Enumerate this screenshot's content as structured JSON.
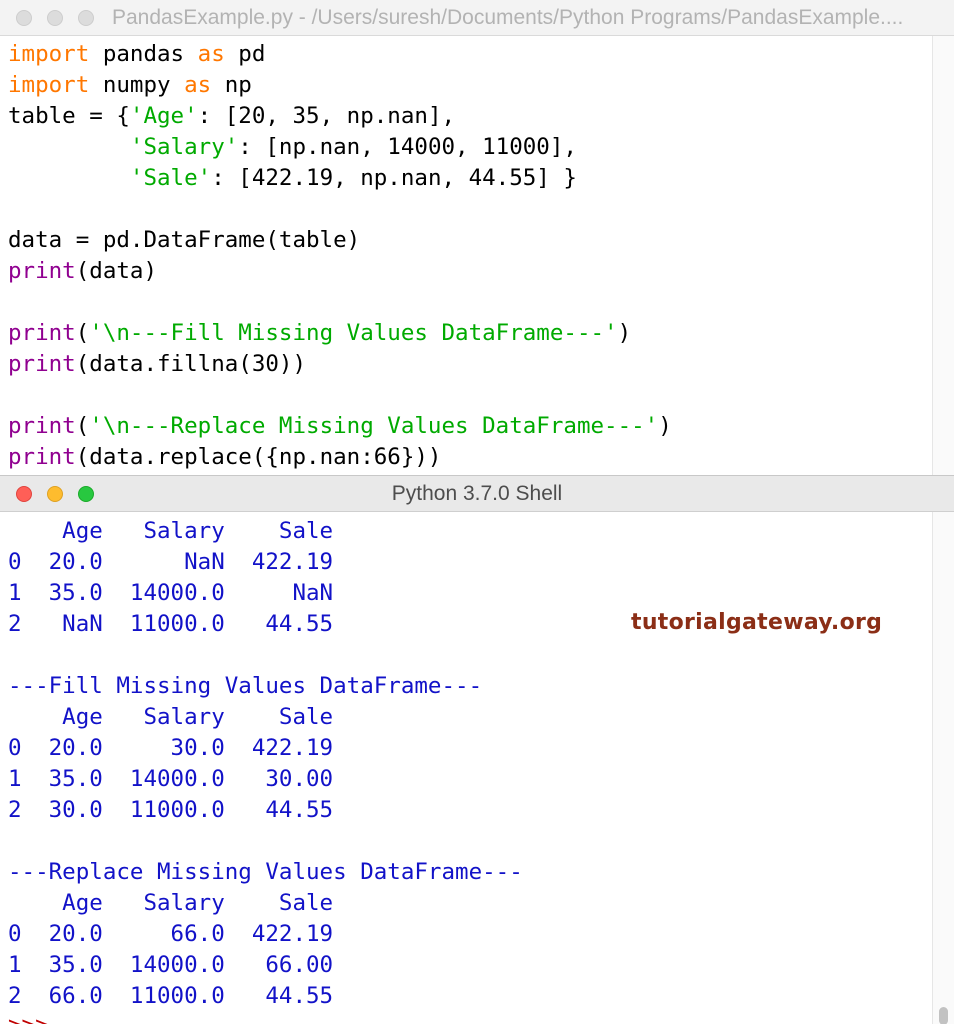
{
  "editor": {
    "title": "PandasExample.py - /Users/suresh/Documents/Python Programs/PandasExample....",
    "code": [
      {
        "id": "l1",
        "parts": [
          {
            "c": "k",
            "t": "import"
          },
          {
            "t": " pandas "
          },
          {
            "c": "k",
            "t": "as"
          },
          {
            "t": " pd"
          }
        ]
      },
      {
        "id": "l2",
        "parts": [
          {
            "c": "k",
            "t": "import"
          },
          {
            "t": " numpy "
          },
          {
            "c": "k",
            "t": "as"
          },
          {
            "t": " np"
          }
        ]
      },
      {
        "id": "l3",
        "parts": [
          {
            "t": "table = {"
          },
          {
            "c": "s",
            "t": "'Age'"
          },
          {
            "t": ": [20, 35, np.nan],"
          }
        ]
      },
      {
        "id": "l4",
        "parts": [
          {
            "t": "         "
          },
          {
            "c": "s",
            "t": "'Salary'"
          },
          {
            "t": ": [np.nan, 14000, 11000],"
          }
        ]
      },
      {
        "id": "l5",
        "parts": [
          {
            "t": "         "
          },
          {
            "c": "s",
            "t": "'Sale'"
          },
          {
            "t": ": [422.19, np.nan, 44.55] }"
          }
        ]
      },
      {
        "id": "l6",
        "parts": []
      },
      {
        "id": "l7",
        "parts": [
          {
            "t": "data = pd.DataFrame(table)"
          }
        ]
      },
      {
        "id": "l8",
        "parts": [
          {
            "c": "b",
            "t": "print"
          },
          {
            "t": "(data)"
          }
        ]
      },
      {
        "id": "l9",
        "parts": []
      },
      {
        "id": "l10",
        "parts": [
          {
            "c": "b",
            "t": "print"
          },
          {
            "t": "("
          },
          {
            "c": "s",
            "t": "'\\n---Fill Missing Values DataFrame---'"
          },
          {
            "t": ")"
          }
        ]
      },
      {
        "id": "l11",
        "parts": [
          {
            "c": "b",
            "t": "print"
          },
          {
            "t": "(data.fillna(30))"
          }
        ]
      },
      {
        "id": "l12",
        "parts": []
      },
      {
        "id": "l13",
        "parts": [
          {
            "c": "b",
            "t": "print"
          },
          {
            "t": "("
          },
          {
            "c": "s",
            "t": "'\\n---Replace Missing Values DataFrame---'"
          },
          {
            "t": ")"
          }
        ]
      },
      {
        "id": "l14",
        "parts": [
          {
            "c": "b",
            "t": "print"
          },
          {
            "t": "(data.replace({np.nan:66}))"
          }
        ]
      }
    ]
  },
  "shell": {
    "title": "Python 3.7.0 Shell",
    "output": [
      "    Age   Salary    Sale",
      "0  20.0      NaN  422.19",
      "1  35.0  14000.0     NaN",
      "2   NaN  11000.0   44.55",
      "",
      "---Fill Missing Values DataFrame---",
      "    Age   Salary    Sale",
      "0  20.0     30.0  422.19",
      "1  35.0  14000.0   30.00",
      "2  30.0  11000.0   44.55",
      "",
      "---Replace Missing Values DataFrame---",
      "    Age   Salary    Sale",
      "0  20.0     66.0  422.19",
      "1  35.0  14000.0   66.00",
      "2  66.0  11000.0   44.55"
    ],
    "prompt": ">>>",
    "watermark": "tutorialgateway.org"
  },
  "colors": {
    "keyword": "#ff7700",
    "string": "#00aa00",
    "builtin": "#900090",
    "output": "#1212c8",
    "close_red": "#ff5f57",
    "minimize_yellow": "#febc2e",
    "zoom_green": "#28c840",
    "inactive_gray": "#dcdcdc"
  }
}
